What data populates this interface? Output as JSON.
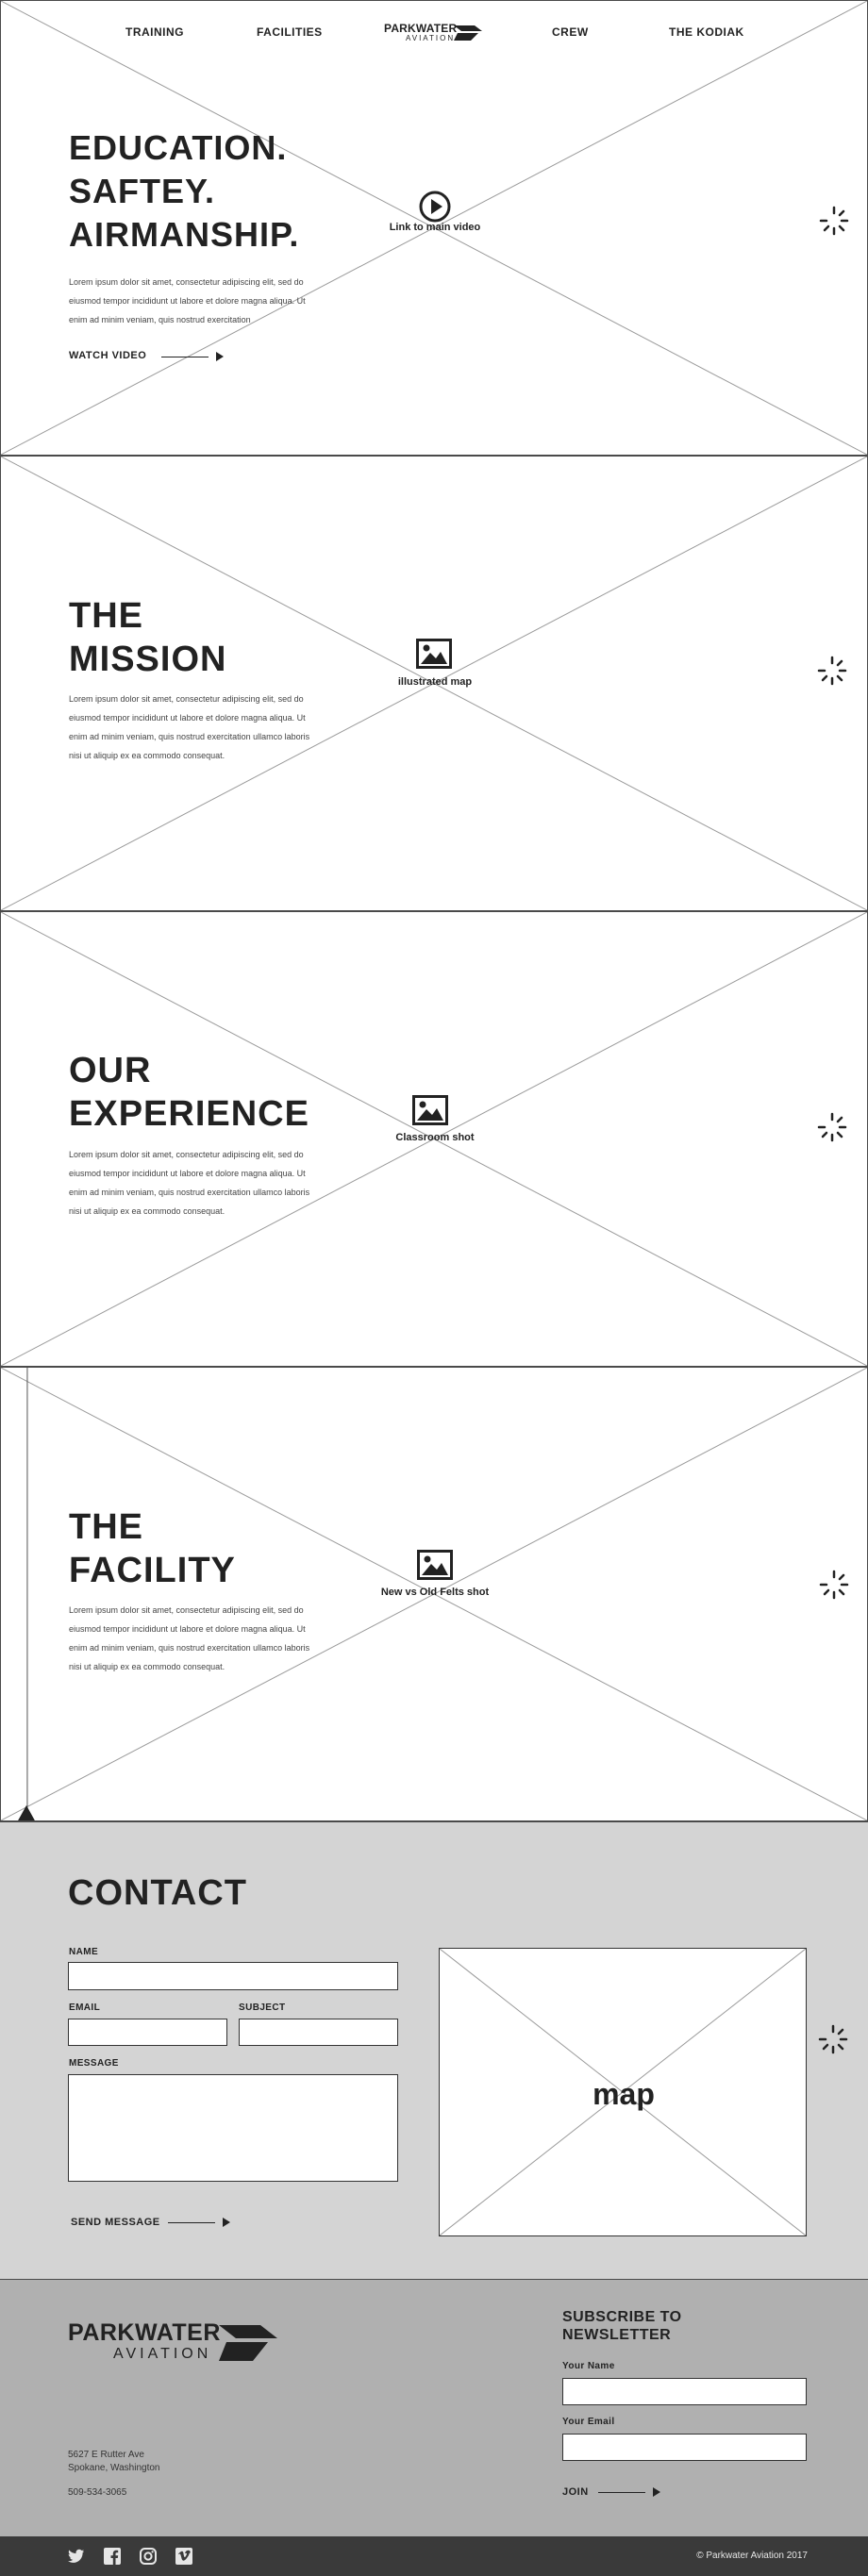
{
  "nav": {
    "items": [
      "TRAINING",
      "FACILITIES",
      "CREW",
      "THE KODIAK"
    ],
    "logo_top": "PARKWATER",
    "logo_bottom": "AVIATION"
  },
  "hero": {
    "title_lines": [
      "EDUCATION.",
      "SAFTEY.",
      "AIRMANSHIP."
    ],
    "body": "Lorem ipsum dolor sit amet, consectetur adipiscing elit, sed do eiusmod tempor incididunt ut labore et dolore magna aliqua. Ut enim ad minim veniam, quis nostrud exercitation",
    "cta": "WATCH VIDEO",
    "center_label": "Link to main video",
    "center_icon": "play-icon"
  },
  "mission": {
    "title_lines": [
      "THE",
      "MISSION"
    ],
    "body": "Lorem ipsum dolor sit amet, consectetur adipiscing elit, sed do eiusmod tempor incididunt ut labore et dolore magna aliqua. Ut enim ad minim veniam, quis nostrud exercitation ullamco laboris nisi ut aliquip ex ea commodo consequat.",
    "center_label": "illustrated map",
    "center_icon": "image-icon"
  },
  "experience": {
    "title_lines": [
      "OUR",
      "EXPERIENCE"
    ],
    "body": "Lorem ipsum dolor sit amet, consectetur adipiscing elit, sed do eiusmod tempor incididunt ut labore et dolore magna aliqua. Ut enim ad minim veniam, quis nostrud exercitation ullamco laboris nisi ut aliquip ex ea commodo consequat.",
    "center_label": "Classroom shot",
    "center_icon": "image-icon"
  },
  "facility": {
    "title_lines": [
      "THE",
      "FACILITY"
    ],
    "body": "Lorem ipsum dolor sit amet, consectetur adipiscing elit, sed do eiusmod tempor incididunt ut labore et dolore magna aliqua. Ut enim ad minim veniam, quis nostrud exercitation ullamco laboris nisi ut aliquip ex ea commodo consequat.",
    "center_label": "New vs Old Felts shot",
    "center_icon": "image-icon"
  },
  "contact": {
    "title": "CONTACT",
    "name_label": "NAME",
    "email_label": "EMAIL",
    "subject_label": "SUBJECT",
    "message_label": "MESSAGE",
    "send": "SEND MESSAGE",
    "map_label": "map"
  },
  "footer": {
    "logo_top": "PARKWATER",
    "logo_bottom": "AVIATION",
    "address_line1": "5627 E Rutter Ave",
    "address_line2": "Spokane, Washington",
    "phone": "509-534-3065",
    "subscribe_line1": "SUBSCRIBE TO",
    "subscribe_line2": "NEWSLETTER",
    "your_name_label": "Your Name",
    "your_email_label": "Your Email",
    "join": "JOIN",
    "social_icons": [
      "twitter-icon",
      "facebook-icon",
      "instagram-icon",
      "vimeo-icon"
    ],
    "copyright": "© Parkwater Aviation 2017"
  },
  "colors": {
    "contact_bg": "#d4d4d4",
    "footer_bg": "#b0b0b0",
    "bottom_bar_bg": "#3a3a3a",
    "ink": "#222222"
  }
}
